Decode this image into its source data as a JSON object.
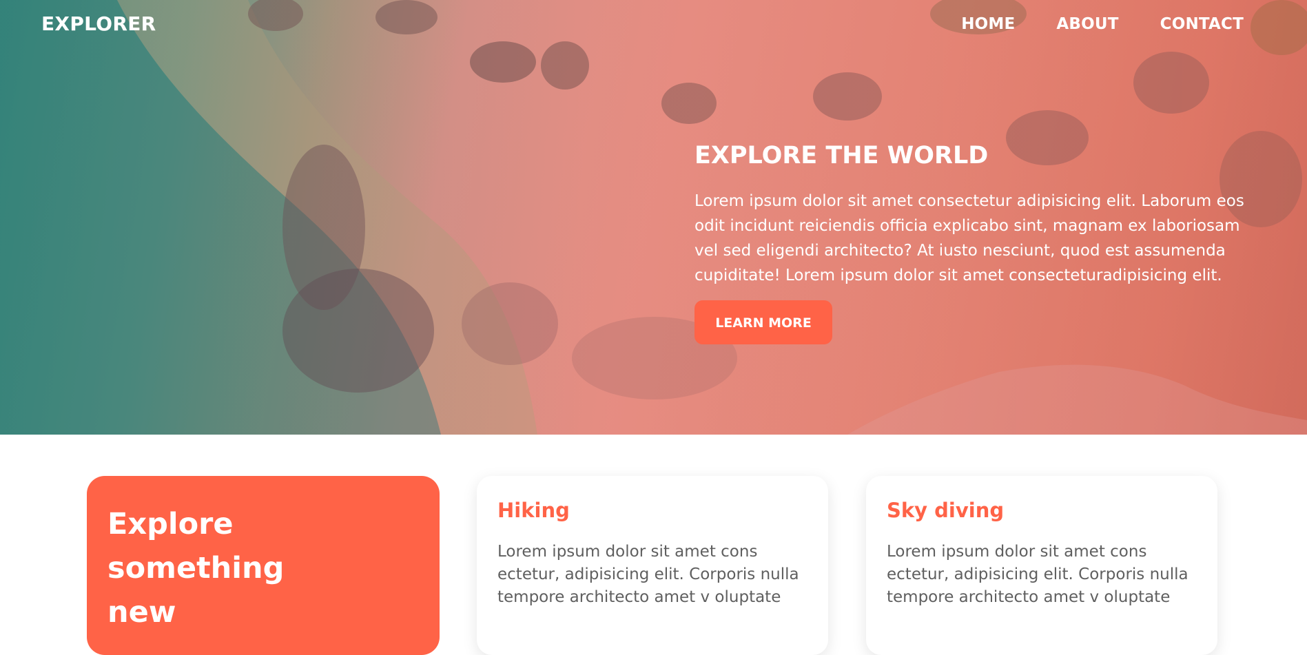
{
  "header": {
    "brand": "EXPLORER",
    "nav": [
      "HOME",
      "ABOUT",
      "CONTACT"
    ]
  },
  "hero": {
    "title": "EXPLORE THE WORLD",
    "text": "Lorem ipsum dolor sit amet consectetur adipisicing elit. Laborum eos odit incidunt reiciendis officia explicabo sint, magnam ex laboriosam vel sed eligendi architecto? At iusto nesciunt, quod est assumenda cupiditate! Lorem ipsum dolor sit amet consecteturadipisicing elit.",
    "button_label": "LEARN MORE"
  },
  "features": {
    "highlight_title": "Explore something new",
    "cards": [
      {
        "title": "Hiking",
        "text": "Lorem ipsum dolor sit amet cons ectetur, adipisicing elit. Corporis nulla tempore architecto amet v oluptate"
      },
      {
        "title": "Sky diving",
        "text": "Lorem ipsum dolor sit amet cons ectetur, adipisicing elit. Corporis nulla tempore architecto amet v oluptate"
      }
    ]
  },
  "colors": {
    "accent": "#ff6347",
    "hero_overlay": "#e38f85",
    "body_text": "#5f5f5f"
  }
}
